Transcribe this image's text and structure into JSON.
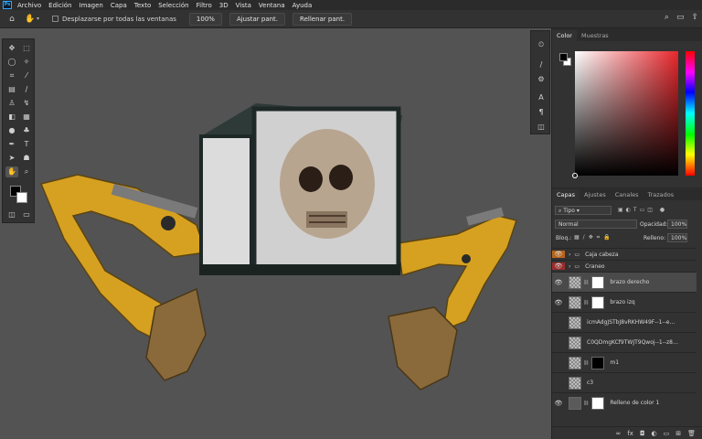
{
  "menu": [
    "Archivo",
    "Edición",
    "Imagen",
    "Capa",
    "Texto",
    "Selección",
    "Filtro",
    "3D",
    "Vista",
    "Ventana",
    "Ayuda"
  ],
  "app_logo": "Ps",
  "options": {
    "scroll_all_label": "Desplazarse por todas las ventanas",
    "zoom_value": "100%",
    "fit_button": "Ajustar pant.",
    "fill_button": "Rellenar pant."
  },
  "color_panel": {
    "tabs": [
      "Color",
      "Muestras"
    ],
    "foreground": "#000000",
    "background": "#ffffff",
    "hue_color": "#e8272c"
  },
  "layers_panel": {
    "tabs": [
      "Capas",
      "Ajustes",
      "Canales",
      "Trazados"
    ],
    "filter_kind": "Tipo",
    "blend_mode": "Normal",
    "opacity_label": "Opacidad:",
    "opacity_value": "100%",
    "lock_label": "Bloq.:",
    "fill_label": "Relleno:",
    "fill_value": "100%",
    "layers": [
      {
        "name": "Caja cabeza",
        "type": "group",
        "visible": true,
        "color_tag": "orange"
      },
      {
        "name": "Craneo",
        "type": "group",
        "visible": true,
        "color_tag": "red"
      },
      {
        "name": "brazo derecho",
        "type": "layer",
        "visible": true,
        "selected": true,
        "mask": true
      },
      {
        "name": "brazo izq",
        "type": "layer",
        "visible": true,
        "mask": true
      },
      {
        "name": "icmAdgJSTbJ8vRKHW49F--1--e7lSw",
        "type": "layer",
        "visible": false
      },
      {
        "name": "C0QDmgKCf9TWJT9Qwoj--1--z8sxe",
        "type": "layer",
        "visible": false
      },
      {
        "name": "m1",
        "type": "layer",
        "visible": false,
        "mask": true
      },
      {
        "name": "c3",
        "type": "layer",
        "visible": false
      },
      {
        "name": "Relleno de color 1",
        "type": "fill",
        "visible": true,
        "mask": true
      }
    ]
  }
}
